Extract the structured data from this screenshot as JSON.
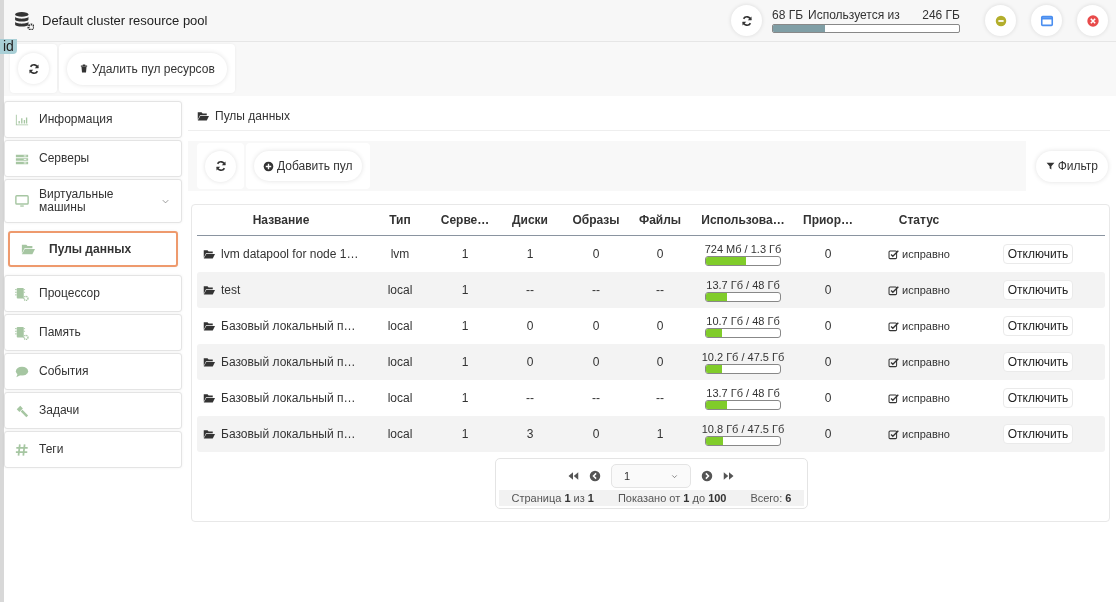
{
  "window": {
    "title": "Default cluster resource pool"
  },
  "storage": {
    "used": "68 ГБ",
    "label": "Используется из",
    "total": "246 ГБ",
    "level": 0.28
  },
  "id_badge": "id",
  "toolbar": [
    {
      "kind": "refresh"
    },
    {
      "kind": "delete",
      "label": "Удалить пул ресурсов"
    }
  ],
  "sidebar": {
    "items": [
      {
        "kind": "info",
        "label": "Информация",
        "selected": false
      },
      {
        "kind": "servers",
        "label": "Серверы",
        "selected": false
      },
      {
        "kind": "vms",
        "label": "Виртуальные машины",
        "selected": false,
        "submenu": true
      },
      {
        "kind": "pools",
        "label": "Пулы данных",
        "selected": true
      },
      {
        "kind": "cpu",
        "label": "Процессор",
        "selected": false
      },
      {
        "kind": "memory",
        "label": "Память",
        "selected": false
      },
      {
        "kind": "events",
        "label": "События",
        "selected": false
      },
      {
        "kind": "tasks",
        "label": "Задачи",
        "selected": false
      },
      {
        "kind": "tags",
        "label": "Теги",
        "selected": false
      }
    ]
  },
  "breadcrumb": "Пулы данных",
  "pools_toolbar": [
    {
      "kind": "refresh"
    },
    {
      "kind": "add",
      "label": "Добавить пул"
    }
  ],
  "filter_button": "Фильтр",
  "table": {
    "columns": [
      "Название",
      "Тип",
      "Серве…",
      "Диски",
      "Образы",
      "Файлы",
      "Использова…",
      "Приор…",
      "Статус"
    ],
    "rows": [
      {
        "name": "lvm datapool for node 1…",
        "type": "lvm",
        "servers": "1",
        "disks": "1",
        "images": "0",
        "files": "0",
        "usage": {
          "text": "724 Мб / 1.3 Гб",
          "level": 0.54
        },
        "priority": "0",
        "status": {
          "text": "исправно",
          "checked": true
        },
        "action": "Отключить"
      },
      {
        "name": "test",
        "type": "local",
        "servers": "1",
        "disks": "--",
        "images": "--",
        "files": "--",
        "usage": {
          "text": "13.7 Гб / 48 Гб",
          "level": 0.29
        },
        "priority": "0",
        "status": {
          "text": "исправно",
          "checked": true
        },
        "action": "Отключить"
      },
      {
        "name": "Базовый локальный п…",
        "type": "local",
        "servers": "1",
        "disks": "0",
        "images": "0",
        "files": "0",
        "usage": {
          "text": "10.7 Гб / 48 Гб",
          "level": 0.22
        },
        "priority": "0",
        "status": {
          "text": "исправно",
          "checked": true
        },
        "action": "Отключить"
      },
      {
        "name": "Базовый локальный п…",
        "type": "local",
        "servers": "1",
        "disks": "0",
        "images": "0",
        "files": "0",
        "usage": {
          "text": "10.2 Гб / 47.5 Гб",
          "level": 0.21
        },
        "priority": "0",
        "status": {
          "text": "исправно",
          "checked": true
        },
        "action": "Отключить"
      },
      {
        "name": "Базовый локальный п…",
        "type": "local",
        "servers": "1",
        "disks": "--",
        "images": "--",
        "files": "--",
        "usage": {
          "text": "13.7 Гб / 48 Гб",
          "level": 0.29
        },
        "priority": "0",
        "status": {
          "text": "исправно",
          "checked": true
        },
        "action": "Отключить"
      },
      {
        "name": "Базовый локальный п…",
        "type": "local",
        "servers": "1",
        "disks": "3",
        "images": "0",
        "files": "1",
        "usage": {
          "text": "10.8 Гб / 47.5 Гб",
          "level": 0.23
        },
        "priority": "0",
        "status": {
          "text": "исправно",
          "checked": true
        },
        "action": "Отключить"
      }
    ]
  },
  "pager": {
    "page": "1",
    "page_info": "Страница **1** из **1**",
    "shown": "Показано от **1** до **100**",
    "total": "Всего: **6**"
  }
}
